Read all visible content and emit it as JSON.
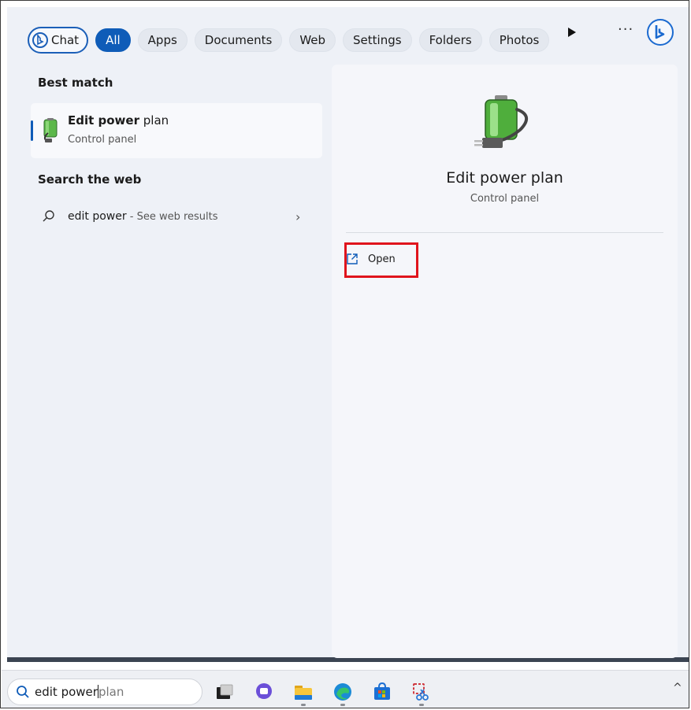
{
  "filters": {
    "chat": "Chat",
    "all": "All",
    "apps": "Apps",
    "documents": "Documents",
    "web": "Web",
    "settings": "Settings",
    "folders": "Folders",
    "photos": "Photos",
    "more": "···"
  },
  "results": {
    "best_match_label": "Best match",
    "best_match": {
      "title_bold": "Edit power",
      "title_rest": " plan",
      "subtitle": "Control panel",
      "icon": "power-plan-battery-icon"
    },
    "search_web_label": "Search the web",
    "web_result": {
      "query": "edit power",
      "hint": " - See web results"
    }
  },
  "preview": {
    "title": "Edit power plan",
    "subtitle": "Control panel",
    "open_label": "Open"
  },
  "taskbar": {
    "search_typed": "edit power",
    "search_suggested": "plan",
    "apps": [
      "task-view",
      "chat-teams",
      "file-explorer",
      "edge",
      "store",
      "snipping-tool"
    ]
  },
  "colors": {
    "accent": "#0f5cb8",
    "highlight_box": "#e0141c"
  }
}
